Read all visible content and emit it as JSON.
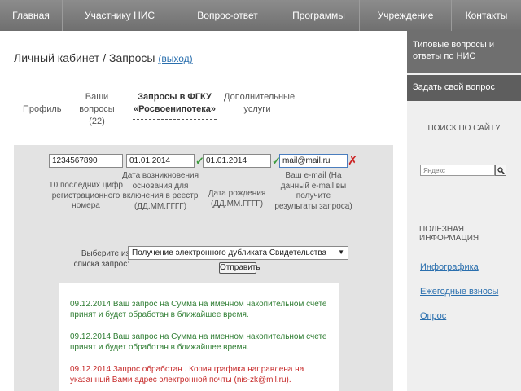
{
  "nav": {
    "items": [
      "Главная",
      "Участнику НИС",
      "Вопрос-ответ",
      "Программы",
      "Учреждение",
      "Контакты"
    ]
  },
  "breadcrumb": {
    "text": "Личный кабинет / Запросы",
    "exit_label": "(выход)"
  },
  "tabs": [
    {
      "label": "Профиль"
    },
    {
      "label": "Ваши вопросы (22)"
    },
    {
      "label": "Запросы в ФГКУ «Росвоенипотека»"
    },
    {
      "label": "Дополнительные услуги"
    }
  ],
  "form": {
    "number_value": "1234567890",
    "number_hint": "10 последних цифр регистрационного номера",
    "date_basis_value": "01.01.2014",
    "date_basis_hint": "Дата возникновения основания для включения в реестр (ДД.ММ.ГГГГ)",
    "birth_date_value": "01.01.2014",
    "birth_date_hint": "Дата рождения (ДД.ММ.ГГГГ)",
    "email_value": "mail@mail.ru",
    "email_hint": "Ваш e-mail (На данный e-mail вы получите результаты запроса)",
    "select_label": "Выберите из списка запрос:",
    "select_value": "Получение электронного дубликата Свидетельства",
    "submit_label": "Отправить"
  },
  "messages": [
    {
      "text": "09.12.2014 Ваш запрос на Сумма на именном накопительном счете принят и будет обработан в ближайшее время.",
      "color": "#2e7d32"
    },
    {
      "text": "09.12.2014 Ваш запрос на Сумма на именном накопительном счете принят и будет обработан в ближайшее время.",
      "color": "#2e7d32"
    },
    {
      "text": "09.12.2014 Запрос обработан . Копия графика направлена на указанный Вами адрес электронной почты (nis-zk@mil.ru).",
      "color": "#c62828"
    }
  ],
  "sidebar": {
    "block1": "Типовые вопросы и ответы по НИС",
    "block2": "Задать свой вопрос",
    "search_title": "ПОИСК ПО САЙТУ",
    "search_placeholder": "Яндекс",
    "useful_title": "ПОЛЕЗНАЯ ИНФОРМАЦИЯ",
    "links": [
      "Инфографика",
      "Ежегодные взносы",
      "Опрос"
    ]
  },
  "icons": {
    "valid": "check-icon",
    "invalid": "x-icon",
    "search": "search-icon",
    "dropdown": "chevron-down-icon"
  }
}
